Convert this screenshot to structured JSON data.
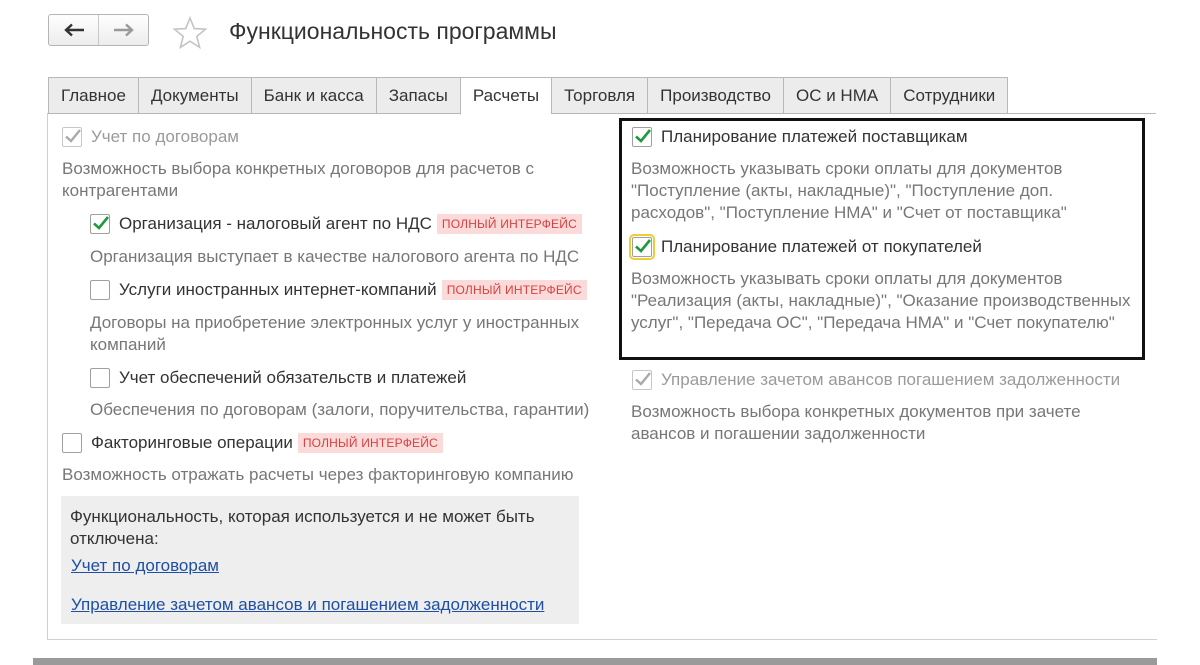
{
  "header": {
    "back_icon": "arrow-left-icon",
    "forward_icon": "arrow-right-icon",
    "favorite_icon": "star-icon",
    "title": "Функциональность программы"
  },
  "tabs": [
    {
      "label": "Главное",
      "active": false
    },
    {
      "label": "Документы",
      "active": false
    },
    {
      "label": "Банк и касса",
      "active": false
    },
    {
      "label": "Запасы",
      "active": false
    },
    {
      "label": "Расчеты",
      "active": true
    },
    {
      "label": "Торговля",
      "active": false
    },
    {
      "label": "Производство",
      "active": false
    },
    {
      "label": "ОС и НМА",
      "active": false
    },
    {
      "label": "Сотрудники",
      "active": false
    }
  ],
  "left": {
    "contracts": {
      "label": "Учет по договорам",
      "checked": true,
      "disabled": true,
      "desc": "Возможность выбора конкретных договоров для расчетов с контрагентами"
    },
    "tax_agent": {
      "label": "Организация - налоговый агент по НДС",
      "badge": "ПОЛНЫЙ ИНТЕРФЕЙС",
      "checked": true,
      "desc": "Организация выступает в качестве налогового агента по НДС"
    },
    "foreign_services": {
      "label": "Услуги иностранных интернет-компаний",
      "badge": "ПОЛНЫЙ ИНТЕРФЕЙС",
      "checked": false,
      "desc": "Договоры на приобретение электронных услуг у иностранных компаний"
    },
    "guarantees": {
      "label": "Учет обеспечений обязательств и платежей",
      "checked": false,
      "desc": "Обеспечения по договорам (залоги, поручительства, гарантии)"
    },
    "factoring": {
      "label": "Факторинговые операции",
      "badge": "ПОЛНЫЙ ИНТЕРФЕЙС",
      "checked": false,
      "desc": "Возможность отражать расчеты через факторинговую компанию"
    }
  },
  "right": {
    "supplier_payments": {
      "label": "Планирование платежей поставщикам",
      "checked": true,
      "desc": "Возможность указывать сроки оплаты для документов \"Поступление (акты, накладные)\", \"Поступление доп. расходов\", \"Поступление НМА\" и \"Счет от поставщика\""
    },
    "customer_payments": {
      "label": "Планирование платежей от покупателей",
      "checked": true,
      "focused": true,
      "desc": "Возможность указывать сроки оплаты для документов \"Реализация (акты, накладные)\", \"Оказание производственных услуг\", \"Передача ОС\", \"Передача НМА\" и \"Счет покупателю\""
    },
    "advances": {
      "label": "Управление зачетом авансов погашением задолженности",
      "checked": true,
      "disabled": true,
      "desc": "Возможность выбора конкретных документов при зачете авансов и погашении задолженности"
    }
  },
  "info_panel": {
    "text": "Функциональность, которая используется и не может быть отключена:",
    "links": [
      "Учет по договорам",
      "Управление зачетом авансов и погашением задолженности"
    ]
  },
  "colors": {
    "check_green": "#1e9a3c",
    "badge_bg": "#fbdada",
    "badge_text": "#d94040",
    "link": "#1f4fa3"
  }
}
